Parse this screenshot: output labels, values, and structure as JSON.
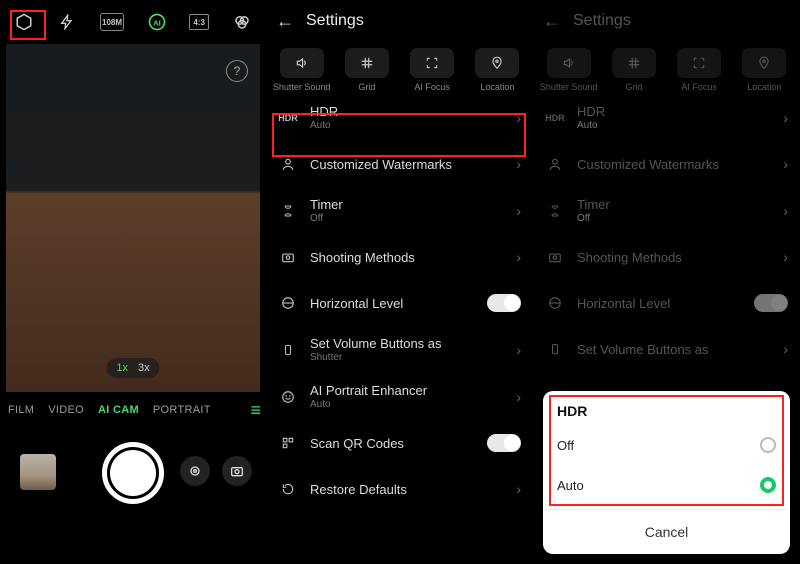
{
  "panel1": {
    "topIcons": [
      "settings-icon",
      "flash-icon",
      "108m-icon",
      "ai-icon",
      "ratio-icon",
      "filter-icon"
    ],
    "mp_label": "108M",
    "ratio_label": "4:3",
    "help_label": "?",
    "zoom": {
      "x1": "1x",
      "x3": "3x"
    },
    "modes": {
      "film": "FILM",
      "video": "VIDEO",
      "aicam": "AI CAM",
      "portrait": "PORTRAIT"
    }
  },
  "panel2": {
    "title": "Settings",
    "quick": [
      {
        "label": "Shutter Sound"
      },
      {
        "label": "Grid"
      },
      {
        "label": "AI Focus"
      },
      {
        "label": "Location"
      }
    ],
    "rows": {
      "hdr": {
        "label": "HDR",
        "sub": "Auto",
        "icon_text": "HDR"
      },
      "watermarks": {
        "label": "Customized Watermarks"
      },
      "timer": {
        "label": "Timer",
        "sub": "Off"
      },
      "shooting": {
        "label": "Shooting Methods"
      },
      "horiz": {
        "label": "Horizontal Level",
        "toggle": true
      },
      "volbtn": {
        "label": "Set Volume Buttons as",
        "sub": "Shutter"
      },
      "aiportrait": {
        "label": "AI Portrait Enhancer",
        "sub": "Auto"
      },
      "qr": {
        "label": "Scan QR Codes",
        "toggle": true
      },
      "restore": {
        "label": "Restore Defaults"
      }
    }
  },
  "panel3": {
    "title": "Settings",
    "quick": [
      {
        "label": "Shutter Sound"
      },
      {
        "label": "Grid"
      },
      {
        "label": "AI Focus"
      },
      {
        "label": "Location"
      }
    ],
    "rows": {
      "hdr": {
        "label": "HDR",
        "sub": "Auto",
        "icon_text": "HDR"
      },
      "watermarks": {
        "label": "Customized Watermarks"
      },
      "timer": {
        "label": "Timer",
        "sub": "Off"
      },
      "shooting": {
        "label": "Shooting Methods"
      },
      "horiz": {
        "label": "Horizontal Level"
      },
      "volbtn": {
        "label": "Set Volume Buttons as"
      }
    },
    "sheet": {
      "title": "HDR",
      "off": "Off",
      "auto": "Auto",
      "cancel": "Cancel"
    }
  }
}
